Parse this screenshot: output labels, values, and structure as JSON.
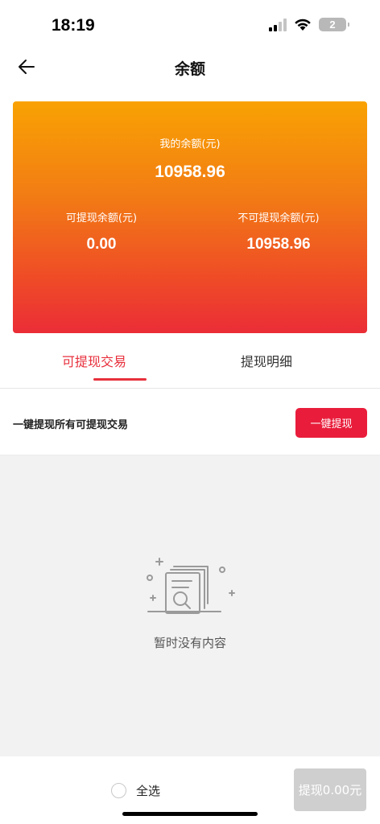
{
  "status_bar": {
    "time": "18:19",
    "battery": "2"
  },
  "nav": {
    "title": "余额",
    "back_icon": "arrow-left-icon"
  },
  "balance_card": {
    "total_label": "我的余额(元)",
    "total_value": "10958.96",
    "withdrawable_label": "可提现余额(元)",
    "withdrawable_value": "0.00",
    "non_withdrawable_label": "不可提现余额(元)",
    "non_withdrawable_value": "10958.96",
    "gradient_colors": [
      "#f9a203",
      "#eb2d37"
    ]
  },
  "tabs": [
    {
      "label": "可提现交易",
      "active": true
    },
    {
      "label": "提现明细",
      "active": false
    }
  ],
  "withdraw_row": {
    "text": "一键提现所有可提现交易",
    "button_label": "一键提现"
  },
  "empty_state": {
    "icon": "empty-document-search-icon",
    "text": "暂时没有内容"
  },
  "bottom_bar": {
    "select_all_label": "全选",
    "submit_label": "提现0.00元"
  },
  "colors": {
    "accent": "#e8303c",
    "button_red": "#e91d3b",
    "disabled": "#cfcfcf"
  }
}
